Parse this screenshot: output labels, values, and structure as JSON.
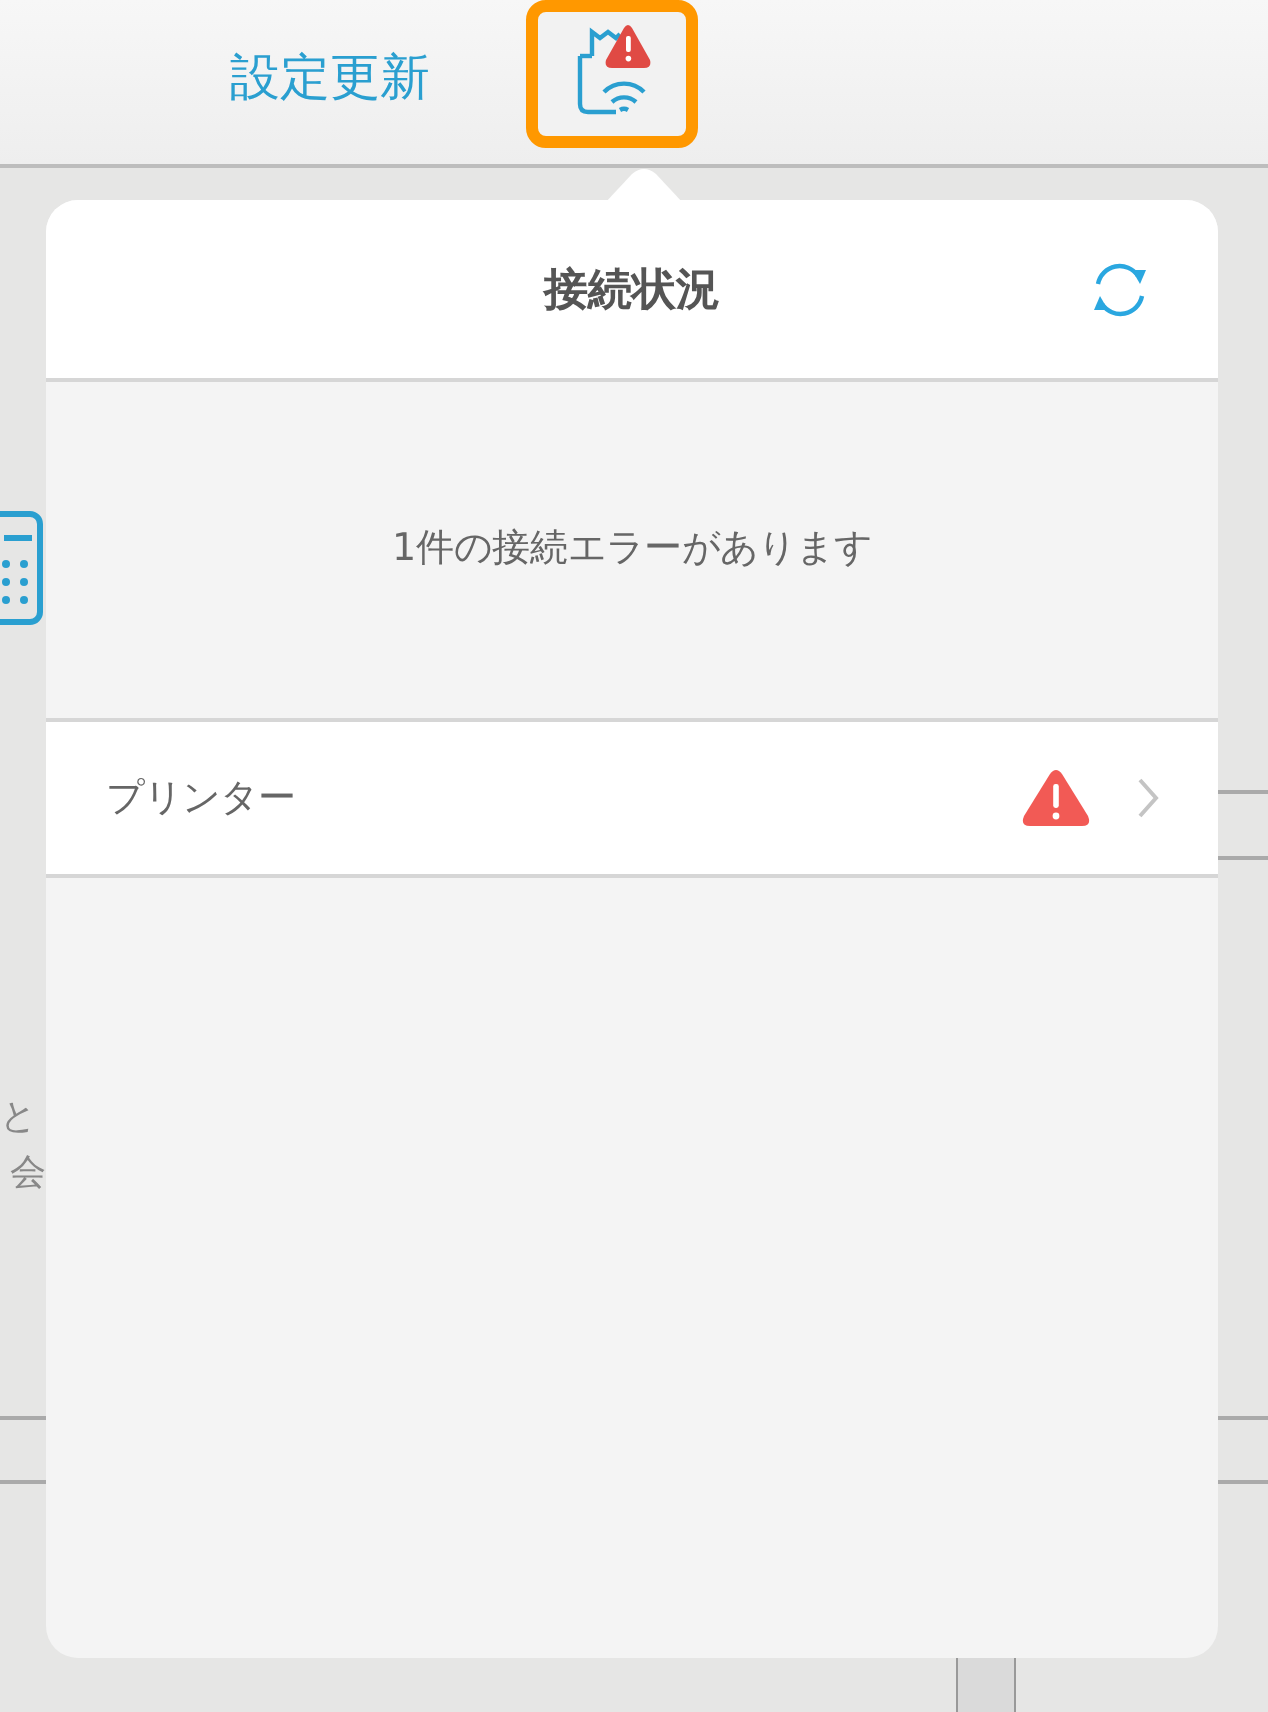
{
  "toolbar": {
    "settings_update": "設定更新",
    "status_button": {
      "alert": true,
      "selected": true
    }
  },
  "background_texts": [
    "と",
    "会"
  ],
  "popover": {
    "title": "接続状況",
    "message": "1件の接続エラーがあります",
    "items": [
      {
        "label": "プリンター",
        "error": true
      }
    ]
  }
}
